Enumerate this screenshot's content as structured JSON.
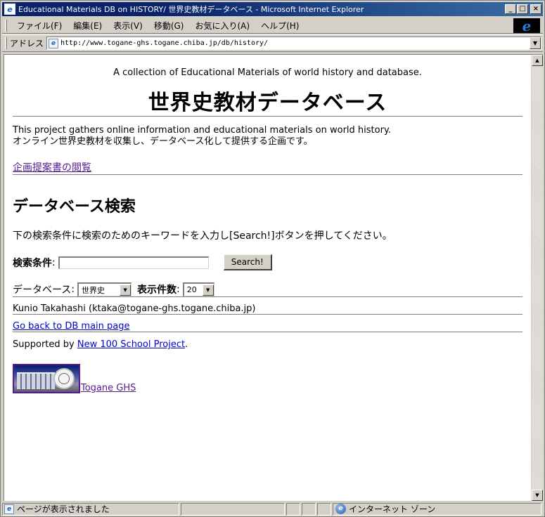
{
  "window": {
    "title": "Educational Materials DB on HISTORY/ 世界史教材データベース - Microsoft Internet Explorer",
    "min_symbol": "_",
    "max_symbol": "□",
    "close_symbol": "×"
  },
  "menu": {
    "items": [
      {
        "label": "ファイル(F)"
      },
      {
        "label": "編集(E)"
      },
      {
        "label": "表示(V)"
      },
      {
        "label": "移動(G)"
      },
      {
        "label": "お気に入り(A)"
      },
      {
        "label": "ヘルプ(H)"
      }
    ]
  },
  "address": {
    "label": "アドレス",
    "url": "http://www.togane-ghs.togane.chiba.jp/db/history/"
  },
  "page": {
    "subtitle": "A collection of Educational Materials of world history and database.",
    "title": "世界史教材データベース",
    "intro_en": "This project gathers online information and educational materials on world history.",
    "intro_ja": "オンライン世界史教材を収集し、データベース化して提供する企画です。",
    "proposal_link": "企画提案書の閲覧",
    "search_heading": "データベース検索",
    "instruction": "下の検索条件に検索のためのキーワードを入力し[Search!]ボタンを押してください。",
    "search_label": "検索条件",
    "colon": ":",
    "search_value": "",
    "search_button": "Search!",
    "db_label": "データベース",
    "db_selected": "世界史",
    "count_label": "表示件数",
    "count_selected": "20",
    "author": "Kunio Takahashi (ktaka@togane-ghs.togane.chiba.jp)",
    "back_link": "Go back to DB main page",
    "supported_prefix": "Supported by ",
    "supported_link": "New 100 School Project",
    "supported_suffix": ".",
    "school_link": "Togane GHS"
  },
  "status": {
    "text": "ページが表示されました",
    "zone": "インターネット ゾーン"
  },
  "colors": {
    "titlebar": "#0a246a",
    "chrome": "#d4d0c8",
    "visited_link": "#551a8b",
    "link": "#0000cc"
  }
}
